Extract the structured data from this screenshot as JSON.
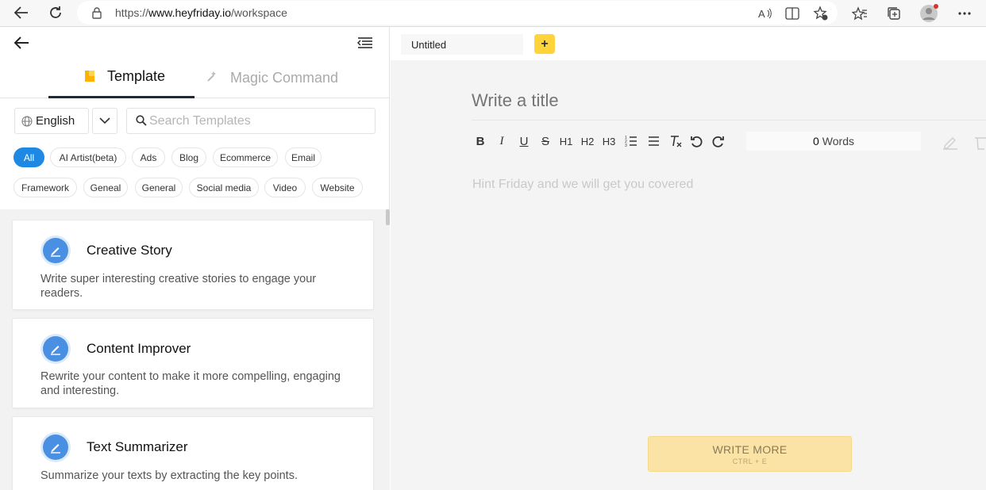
{
  "browser": {
    "url_prefix": "https://",
    "url_host": "www.heyfriday.io",
    "url_path": "/workspace"
  },
  "left": {
    "tabs": [
      {
        "label": "Template",
        "active": true
      },
      {
        "label": "Magic Command",
        "active": false
      }
    ],
    "language": "English",
    "search_placeholder": "Search Templates",
    "categories_row1": [
      "All",
      "AI Artist(beta)",
      "Ads",
      "Blog",
      "Ecommerce",
      "Email"
    ],
    "categories_row2": [
      "Framework",
      "Geneal",
      "General",
      "Social media",
      "Video",
      "Website"
    ],
    "active_category": "All",
    "cards": [
      {
        "title": "Creative Story",
        "desc": "Write super interesting creative stories to engage your readers."
      },
      {
        "title": "Content Improver",
        "desc": "Rewrite your content to make it more compelling, engaging and interesting."
      },
      {
        "title": "Text Summarizer",
        "desc": "Summarize your texts by extracting the key points."
      }
    ]
  },
  "editor": {
    "doc_tab": "Untitled",
    "add_label": "+",
    "title_placeholder": "Write a title",
    "word_count": "0",
    "word_label": "Words",
    "hint": "Hint Friday and we will get you covered",
    "write_more": "WRITE MORE",
    "write_more_shortcut": "CTRL + E",
    "toolbar": {
      "bold": "B",
      "italic": "I",
      "underline": "U",
      "strike": "S",
      "h1": "H1",
      "h2": "H2",
      "h3": "H3"
    }
  },
  "colors": {
    "accent": "#1e88e5",
    "add_button": "#ffd43b",
    "write_more_bg": "#fbe3a6"
  }
}
